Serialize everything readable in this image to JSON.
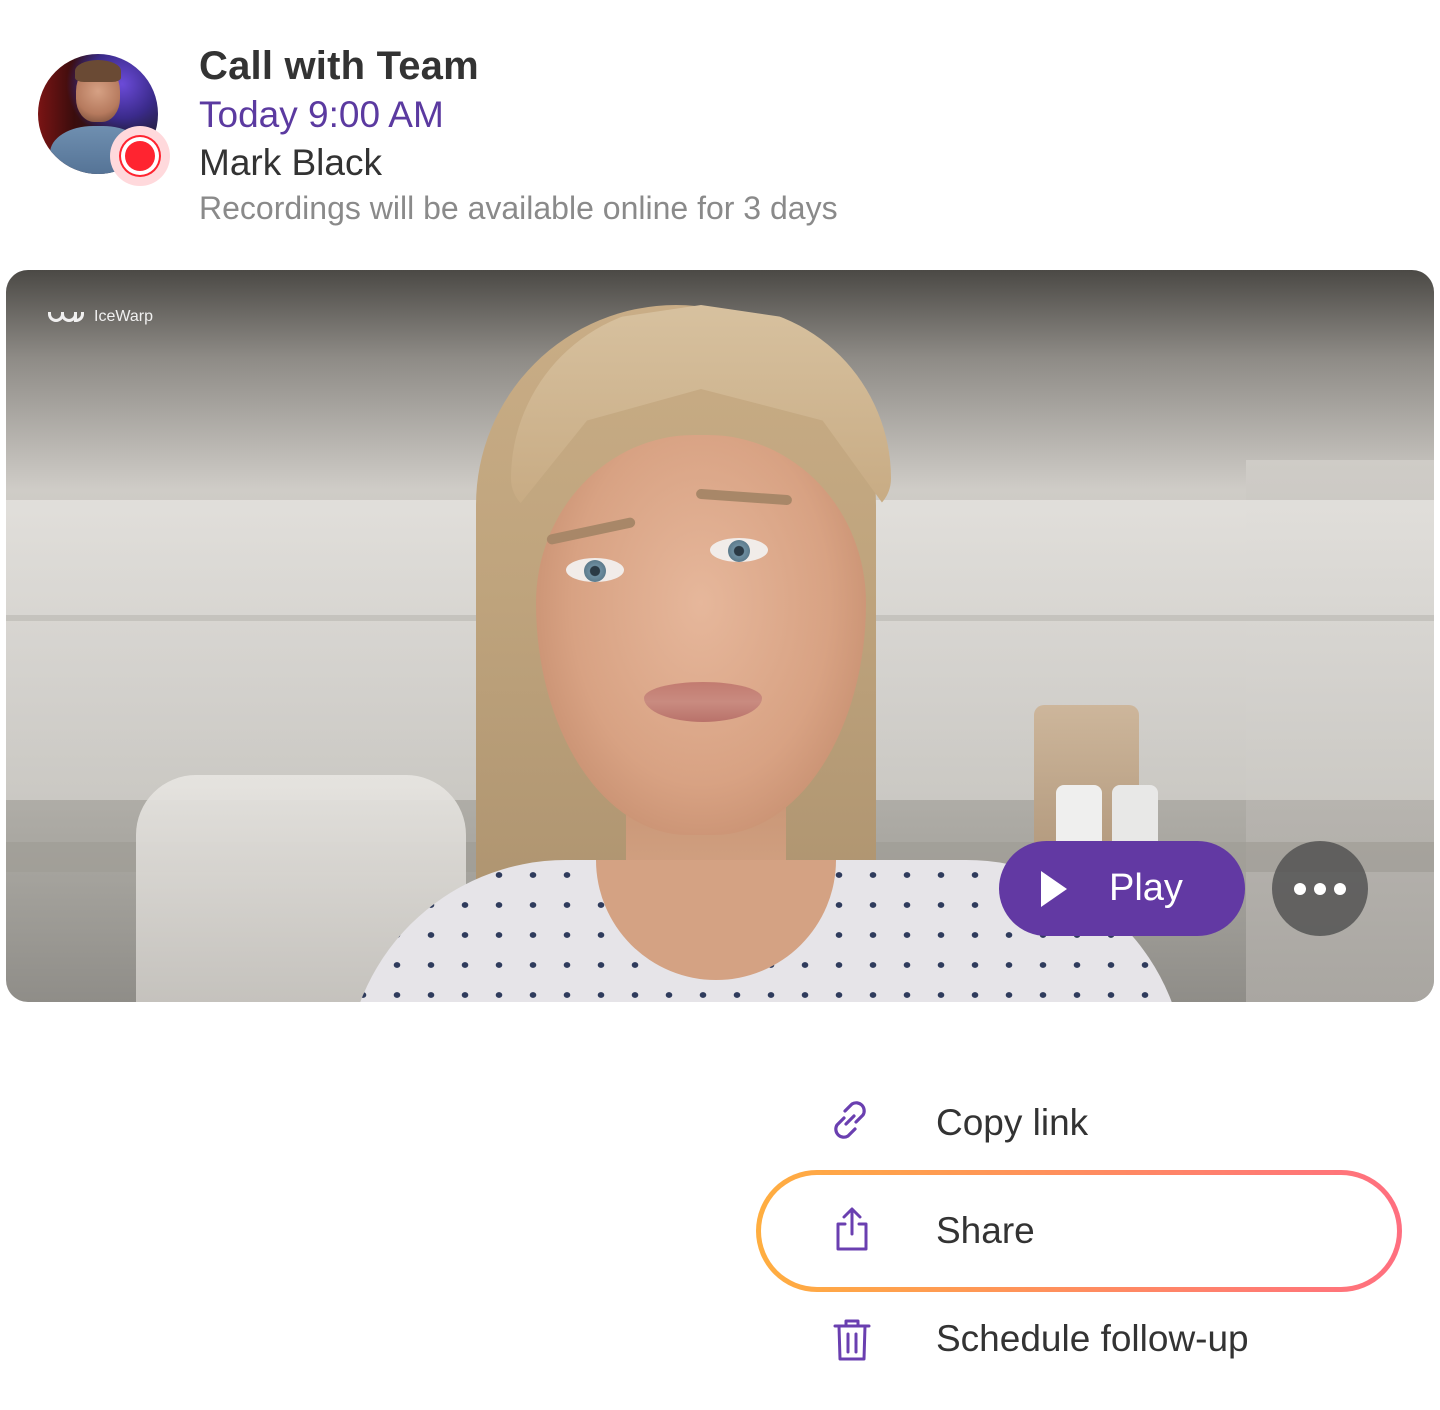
{
  "header": {
    "title": "Call with Team",
    "time": "Today 9:00 AM",
    "organizer": "Mark Black",
    "note": "Recordings will be available online for 3 days"
  },
  "video": {
    "logo_text": "IceWarp",
    "play_label": "Play"
  },
  "menu": {
    "items": [
      {
        "label": "Copy link",
        "icon": "link-icon"
      },
      {
        "label": "Share",
        "icon": "share-icon",
        "highlighted": true
      },
      {
        "label": "Schedule follow-up",
        "icon": "trash-icon"
      }
    ]
  },
  "colors": {
    "accent": "#6239a3",
    "time_text": "#5b3aa0",
    "record_red": "#ff2430",
    "highlight_gradient_start": "#ffae40",
    "highlight_gradient_end": "#ff6f80",
    "icon_purple": "#6a3fb0"
  }
}
